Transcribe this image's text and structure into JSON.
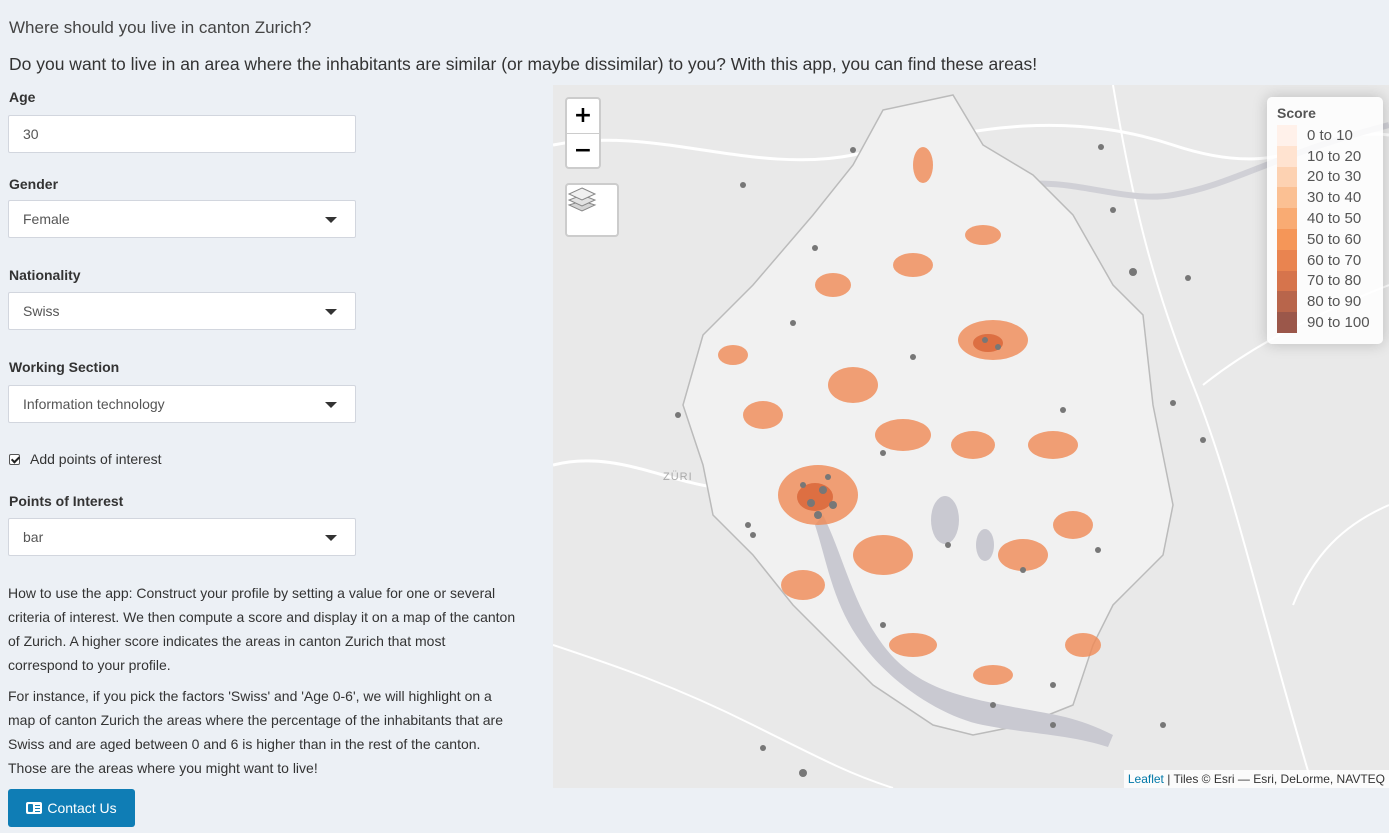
{
  "header": {
    "title": "Where should you live in canton Zurich?",
    "subtitle": "Do you want to live in an area where the inhabitants are similar (or maybe dissimilar) to you? With this app, you can find these areas!"
  },
  "form": {
    "age": {
      "label": "Age",
      "value": "30"
    },
    "gender": {
      "label": "Gender",
      "value": "Female"
    },
    "nationality": {
      "label": "Nationality",
      "value": "Swiss"
    },
    "working_section": {
      "label": "Working Section",
      "value": "Information technology"
    },
    "poi_checkbox": {
      "label": "Add points of interest",
      "checked": true
    },
    "points_of_interest": {
      "label": "Points of Interest",
      "value": "bar"
    }
  },
  "help": {
    "paragraph1": "How to use the app: Construct your profile by setting a value for one or several criteria of interest. We then compute a score and display it on a map of the canton of Zurich. A higher score indicates the areas in canton Zurich that most correspond to your profile.",
    "paragraph2": "For instance, if you pick the factors 'Swiss' and 'Age 0-6', we will highlight on a map of canton Zurich the areas where the percentage of the inhabitants that are Swiss and are aged between 0 and 6 is higher than in the rest of the canton. Those are the areas where you might want to live!"
  },
  "contact": {
    "label": "Contact Us",
    "icon": "id-card-icon",
    "color": "#0f7db5"
  },
  "map": {
    "zoom_in": "+",
    "zoom_out": "−",
    "layers_icon": "layers-icon",
    "city_label": "ZÜRI",
    "legend": {
      "title": "Score",
      "items": [
        {
          "label": "0 to 10",
          "color": "#fff1ea"
        },
        {
          "label": "10 to 20",
          "color": "#ffe3d0"
        },
        {
          "label": "20 to 30",
          "color": "#fdd2b2"
        },
        {
          "label": "30 to 40",
          "color": "#fbc093"
        },
        {
          "label": "40 to 50",
          "color": "#f9ab73"
        },
        {
          "label": "50 to 60",
          "color": "#f59658"
        },
        {
          "label": "60 to 70",
          "color": "#e98450"
        },
        {
          "label": "70 to 80",
          "color": "#d6744c"
        },
        {
          "label": "80 to 90",
          "color": "#b8654b"
        },
        {
          "label": "90 to 100",
          "color": "#9b574a"
        }
      ]
    },
    "attribution": {
      "leaflet": "Leaflet",
      "rest": " | Tiles © Esri — Esri, DeLorme, NAVTEQ"
    }
  }
}
